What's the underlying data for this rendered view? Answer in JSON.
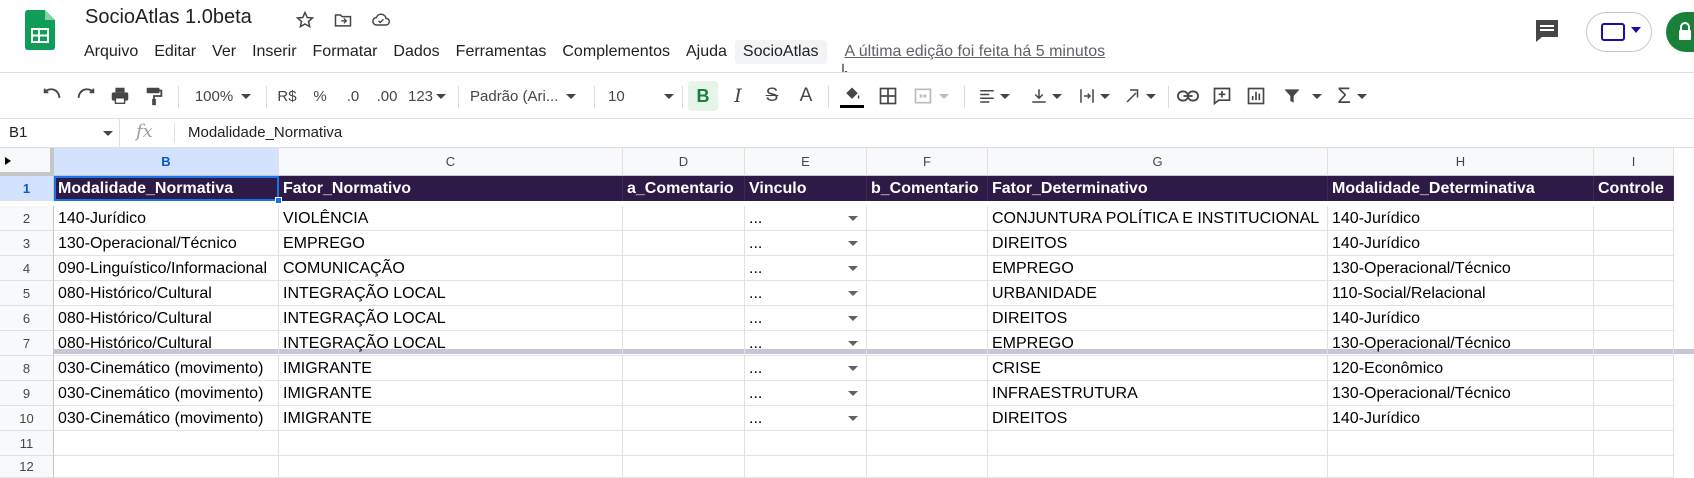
{
  "app": {
    "title": "SocioAtlas 1.0beta",
    "brand_color": "#188038",
    "header_fill": "#2e1a47",
    "accent": "#1a73e8"
  },
  "menu": {
    "items": [
      "Arquivo",
      "Editar",
      "Ver",
      "Inserir",
      "Formatar",
      "Dados",
      "Ferramentas",
      "Complementos",
      "Ajuda",
      "SocioAtlas"
    ],
    "active": "SocioAtlas",
    "last_edit": "A última edição foi feita há 5 minutos"
  },
  "toolbar": {
    "zoom": "100%",
    "currency": "R$",
    "percent": "%",
    "decrease_decimals": ".0",
    "increase_decimals": ".00",
    "more_formats": "123",
    "font": "Padrão (Ari...",
    "font_size": "10",
    "bold": "B",
    "italic": "I",
    "strikethrough": "S",
    "text_color": "A",
    "sum": "Σ"
  },
  "formula_bar": {
    "cell_ref": "B1",
    "fx": "fx",
    "content": "Modalidade_Normativa"
  },
  "grid": {
    "columns": [
      "B",
      "C",
      "D",
      "E",
      "F",
      "G",
      "H",
      "I"
    ],
    "selected_column": "B",
    "row_numbers": [
      "1",
      "2",
      "3",
      "4",
      "5",
      "6",
      "7",
      "8",
      "9",
      "10",
      "11",
      "12"
    ],
    "selected_row": "1",
    "header_row": [
      "Modalidade_Normativa",
      "Fator_Normativo",
      "a_Comentario",
      "Vinculo",
      "b_Comentario",
      "Fator_Determinativo",
      "Modalidade_Determinativa",
      "Controle"
    ],
    "rows": [
      [
        "140-Jurídico",
        "VIOLÊNCIA",
        "",
        "...",
        "",
        "CONJUNTURA POLÍTICA E INSTITUCIONAL",
        "140-Jurídico",
        ""
      ],
      [
        "130-Operacional/Técnico",
        "EMPREGO",
        "",
        "...",
        "",
        "DIREITOS",
        "140-Jurídico",
        ""
      ],
      [
        "090-Linguístico/Informacional",
        "COMUNICAÇÃO",
        "",
        "...",
        "",
        "EMPREGO",
        "130-Operacional/Técnico",
        ""
      ],
      [
        "080-Histórico/Cultural",
        "INTEGRAÇÃO LOCAL",
        "",
        "...",
        "",
        "URBANIDADE",
        "110-Social/Relacional",
        ""
      ],
      [
        "080-Histórico/Cultural",
        "INTEGRAÇÃO LOCAL",
        "",
        "...",
        "",
        "DIREITOS",
        "140-Jurídico",
        ""
      ],
      [
        "080-Histórico/Cultural",
        "INTEGRAÇÃO LOCAL",
        "",
        "...",
        "",
        "EMPREGO",
        "130-Operacional/Técnico",
        ""
      ],
      [
        "030-Cinemático (movimento)",
        "IMIGRANTE",
        "",
        "...",
        "",
        "CRISE",
        "120-Econômico",
        ""
      ],
      [
        "030-Cinemático (movimento)",
        "IMIGRANTE",
        "",
        "...",
        "",
        "INFRAESTRUTURA",
        "130-Operacional/Técnico",
        ""
      ],
      [
        "030-Cinemático (movimento)",
        "IMIGRANTE",
        "",
        "...",
        "",
        "DIREITOS",
        "140-Jurídico",
        ""
      ],
      [
        "",
        "",
        "",
        "",
        "",
        "",
        "",
        ""
      ],
      [
        "",
        "",
        "",
        "",
        "",
        "",
        "",
        ""
      ]
    ]
  }
}
